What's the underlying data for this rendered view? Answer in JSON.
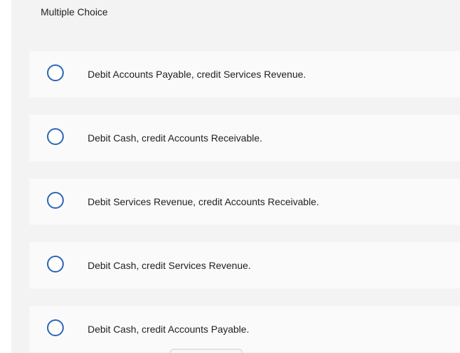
{
  "header": {
    "title": "Multiple Choice"
  },
  "options": [
    {
      "label": "Debit Accounts Payable, credit Services Revenue."
    },
    {
      "label": "Debit Cash, credit Accounts Receivable."
    },
    {
      "label": "Debit Services Revenue, credit Accounts Receivable."
    },
    {
      "label": "Debit Cash, credit Services Revenue."
    },
    {
      "label": "Debit Cash, credit Accounts Payable."
    }
  ],
  "colors": {
    "radio_border": "#2b66b3",
    "panel_bg": "#f3f3f3",
    "option_bg": "#fafafa"
  }
}
